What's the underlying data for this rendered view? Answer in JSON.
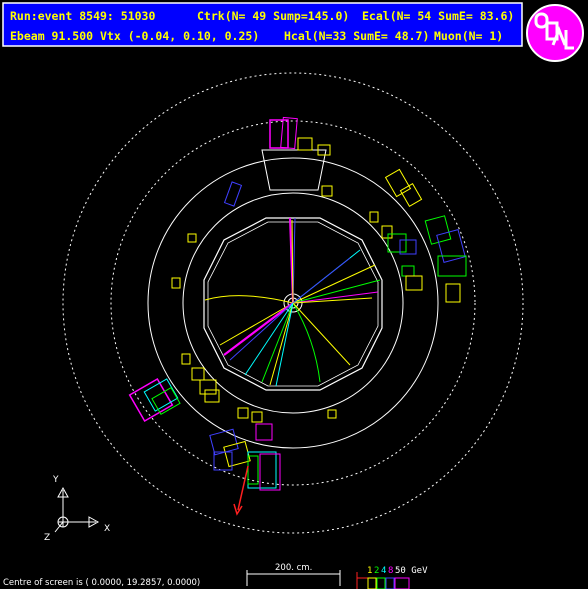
{
  "header": {
    "line1": {
      "run_event": "Run:event  8549:  51030",
      "ctrk": "Ctrk(N= 49  Sump=145.0)",
      "ecal": "Ecal(N= 54  SumE=  83.6)"
    },
    "line2": {
      "ebeam_vtx": "Ebeam 91.500  Vtx (-0.04,  0.10,  0.25)",
      "hcal": "Hcal(N=33  SumE=  48.7)",
      "muon": "Muon(N=  1)"
    }
  },
  "logo": {
    "text": "OPAL",
    "brand_color": "#ff00ff"
  },
  "axes": {
    "y_label": "Y",
    "x_label": "X",
    "z_label": "Z"
  },
  "footer": {
    "screen_centre": "Centre of screen is (     0.0000,    19.2857,      0.0000)",
    "scale_label": "200. cm.",
    "energy_digits": [
      "1",
      "2",
      "4",
      "8",
      "50 GeV"
    ]
  },
  "colors": {
    "header_bg": "#0000ff",
    "header_text": "#ffff00",
    "track_yellow": "#ffff00",
    "track_green": "#00ff00",
    "track_magenta": "#ff00ff",
    "track_cyan": "#00ffff",
    "track_blue": "#4040ff",
    "muon_red": "#ff2020",
    "detector_white": "#ffffff"
  }
}
